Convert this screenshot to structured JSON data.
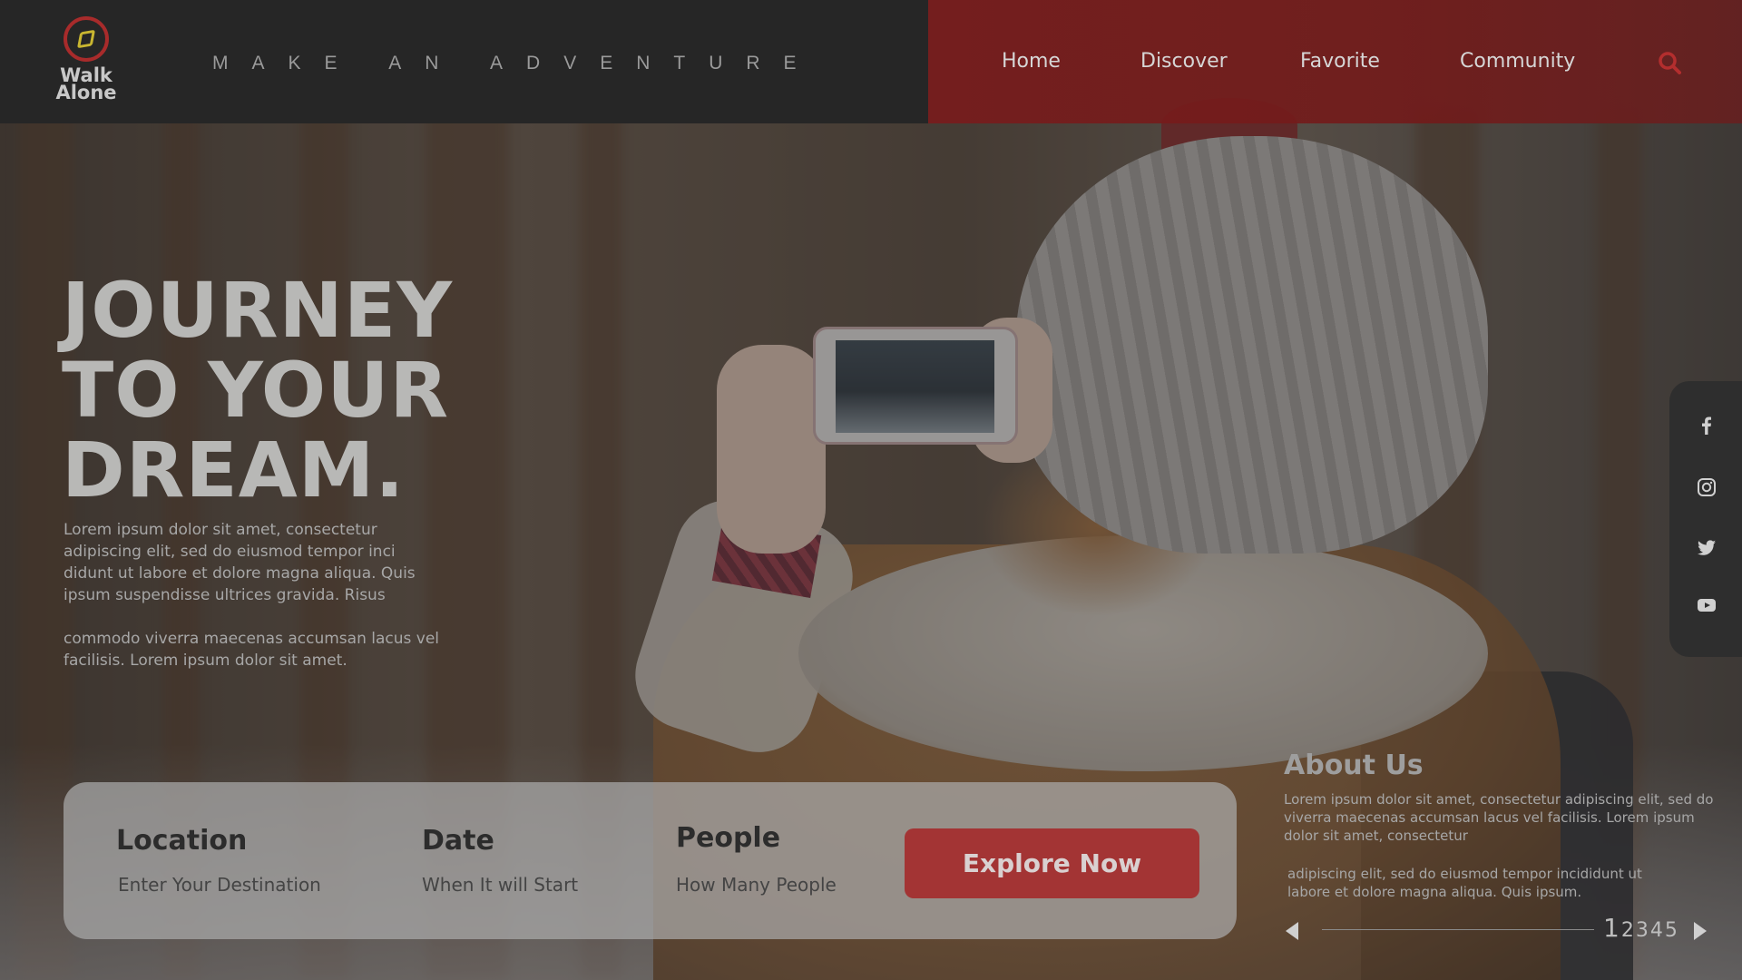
{
  "header": {
    "logo_line1": "Walk",
    "logo_line2": "Alone",
    "tagline": "MAKE AN ADVENTURE",
    "nav": [
      "Home",
      "Discover",
      "Favorite",
      "Community"
    ],
    "search_icon": "search-icon",
    "accent": "#a82b2b"
  },
  "hero": {
    "title_lines": [
      "JOURNEY",
      "TO YOUR",
      "DREAM."
    ],
    "paragraph1": "Lorem ipsum dolor sit amet, consectetur adipiscing elit, sed do eiusmod tempor inci didunt ut labore et dolore magna aliqua. Quis ipsum suspendisse ultrices gravida. Risus",
    "paragraph2": "commodo viverra maecenas accumsan lacus vel facilisis. Lorem ipsum dolor sit amet."
  },
  "social": [
    "facebook-icon",
    "instagram-icon",
    "twitter-icon",
    "youtube-icon"
  ],
  "search_panel": {
    "location_label": "Location",
    "location_placeholder": "Enter Your Destination",
    "date_label": "Date",
    "date_placeholder": "When It will Start",
    "people_label": "People",
    "people_placeholder": "How Many People",
    "button_label": "Explore Now",
    "button_color": "#a33434"
  },
  "about": {
    "title": "About Us",
    "paragraph1": "Lorem ipsum dolor sit amet, consectetur adipiscing elit, sed do viverra maecenas accumsan lacus vel facilisis. Lorem ipsum dolor sit amet, consectetur",
    "paragraph2": "adipiscing elit, sed do eiusmod tempor incididunt ut labore et dolore magna aliqua. Quis ipsum."
  },
  "pager": {
    "current": "1",
    "rest": "2345"
  }
}
